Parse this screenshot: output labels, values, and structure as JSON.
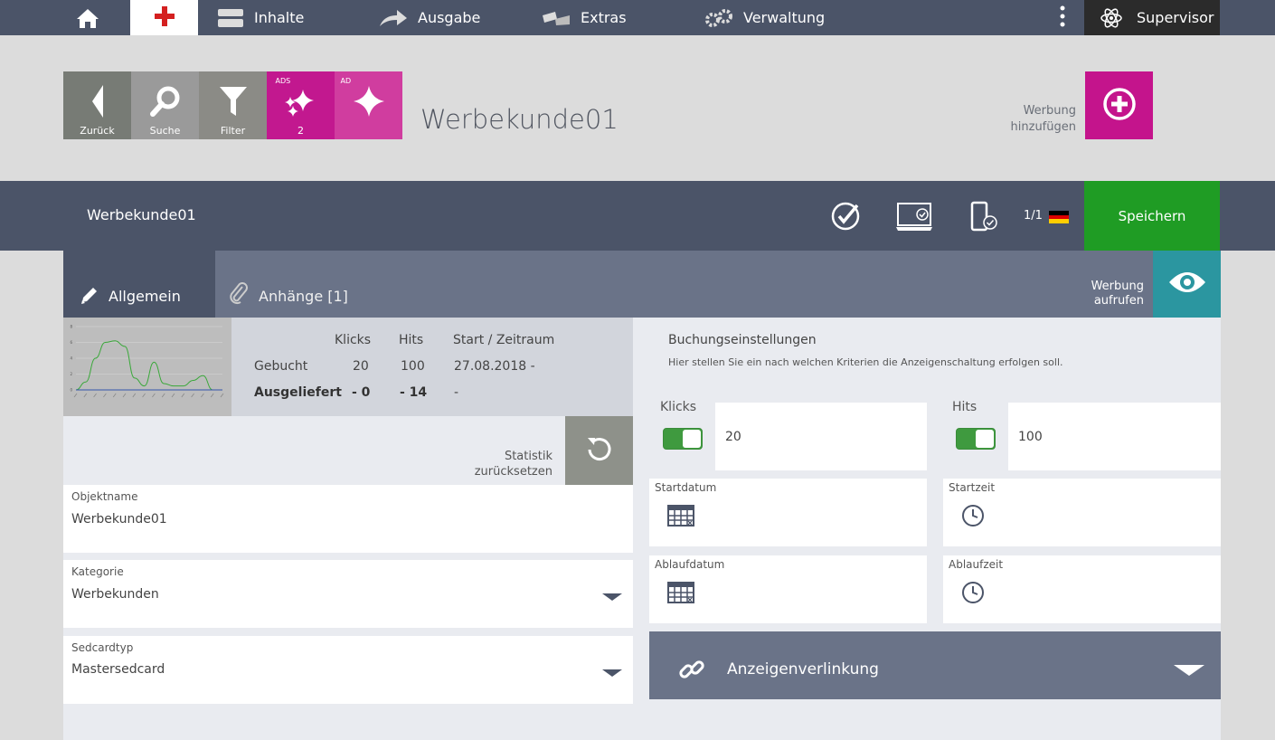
{
  "nav": {
    "home_icon": "home-icon",
    "medical_icon": "red-cross-icon",
    "inhalte": "Inhalte",
    "ausgabe": "Ausgabe",
    "extras": "Extras",
    "verwaltung": "Verwaltung",
    "supervisor": "Supervisor"
  },
  "toolbar": {
    "back": "Zurück",
    "search": "Suche",
    "filter": "Filter",
    "ads_count": "2",
    "ads_icon_text": "ADS",
    "ad_icon_text": "AD"
  },
  "page_title": "Werbekunde01",
  "add_ad": {
    "line1": "Werbung",
    "line2": "hinzufügen"
  },
  "record": {
    "title": "Werbekunde01",
    "pager": "1/1",
    "save": "Speichern",
    "flag_colors": [
      "#000000",
      "#dd0000",
      "#ffce00"
    ]
  },
  "tabs": {
    "allgemein": "Allgemein",
    "anhaenge": "Anhänge [1]"
  },
  "view_ad": {
    "line1": "Werbung",
    "line2": "aufrufen"
  },
  "stats": {
    "headers": [
      "Klicks",
      "Hits",
      "Start / Zeitraum"
    ],
    "rows": [
      {
        "label": "Gebucht",
        "klicks": "20",
        "hits": "100",
        "start": "27.08.2018 -"
      },
      {
        "label": "Ausgeliefert",
        "klicks": "- 0",
        "hits": "- 14",
        "start": "-"
      }
    ],
    "reset_line1": "Statistik",
    "reset_line2": "zurücksetzen"
  },
  "fields": {
    "objektname": {
      "label": "Objektname",
      "value": "Werbekunde01"
    },
    "kategorie": {
      "label": "Kategorie",
      "value": "Werbekunden"
    },
    "sedcardtyp": {
      "label": "Sedcardtyp",
      "value": "Mastersedcard"
    }
  },
  "booking": {
    "title": "Buchungseinstellungen",
    "description": "Hier stellen Sie ein nach welchen Kriterien die Anzeigenschaltung erfolgen soll.",
    "klicks_label": "Klicks",
    "klicks_value": "20",
    "klicks_enabled": true,
    "hits_label": "Hits",
    "hits_value": "100",
    "hits_enabled": true,
    "startdatum": "Startdatum",
    "startzeit": "Startzeit",
    "ablaufdatum": "Ablaufdatum",
    "ablaufzeit": "Ablaufzeit"
  },
  "linking": {
    "label": "Anzeigenverlinkung"
  },
  "chart_data": {
    "type": "line",
    "series": [
      {
        "values": [
          0,
          1,
          4,
          6,
          6.2,
          5.5,
          1.5,
          0.5,
          3.5,
          0.8,
          0.5,
          0.5,
          1.2,
          1.8,
          0,
          0
        ]
      },
      {
        "values": [
          0,
          0,
          0,
          0,
          0,
          0,
          0,
          0,
          0,
          0,
          0,
          0,
          0,
          0,
          0,
          0
        ]
      }
    ],
    "colors": [
      "#3aa83a",
      "#3355aa"
    ],
    "ylim": [
      0,
      8
    ],
    "y_ticks": [
      0,
      2,
      4,
      6,
      8
    ],
    "grid": true
  }
}
